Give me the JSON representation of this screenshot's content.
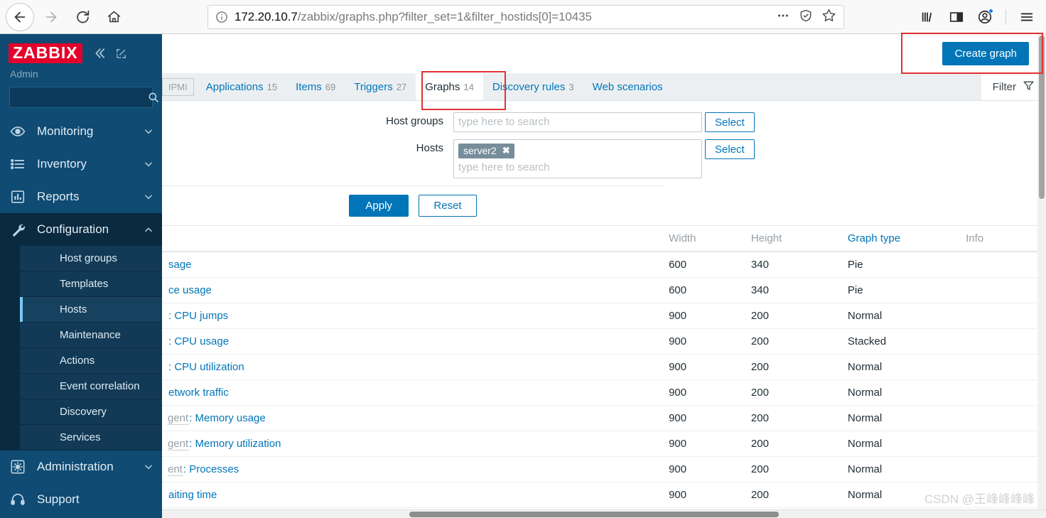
{
  "browser": {
    "back_label": "Back",
    "forward_label": "Forward",
    "reload_label": "Reload",
    "home_label": "Home",
    "url_bold": "172.20.10.7",
    "url_rest": "/zabbix/graphs.php?filter_set=1&filter_hostids[0]=10435",
    "page_actions_label": "Page actions",
    "reader_label": "Reader view",
    "bookmark_label": "Bookmark this page",
    "library_label": "Library",
    "sidebars_label": "Sidebars",
    "account_label": "Account",
    "menu_label": "Open application menu"
  },
  "sidebar": {
    "logo": "ZABBIX",
    "user": "Admin",
    "search_placeholder": "",
    "collapse_label": "Collapse sidebar",
    "expand_label": "Hide sidebar",
    "items": [
      {
        "label": "Monitoring",
        "icon": "eye-icon",
        "expandable": true
      },
      {
        "label": "Inventory",
        "icon": "list-icon",
        "expandable": true
      },
      {
        "label": "Reports",
        "icon": "bar-chart-icon",
        "expandable": true
      },
      {
        "label": "Configuration",
        "icon": "wrench-icon",
        "expandable": true,
        "expanded": true
      },
      {
        "label": "Administration",
        "icon": "gear-icon",
        "expandable": true
      },
      {
        "label": "Support",
        "icon": "headset-icon",
        "expandable": false
      }
    ],
    "configuration_submenu": [
      {
        "label": "Host groups"
      },
      {
        "label": "Templates"
      },
      {
        "label": "Hosts",
        "current": true
      },
      {
        "label": "Maintenance"
      },
      {
        "label": "Actions"
      },
      {
        "label": "Event correlation"
      },
      {
        "label": "Discovery"
      },
      {
        "label": "Services"
      }
    ]
  },
  "header": {
    "create_graph_label": "Create graph"
  },
  "tabs": [
    {
      "label": "IPMI",
      "count": "",
      "state": "disabled"
    },
    {
      "label": "Applications",
      "count": "15",
      "state": "link"
    },
    {
      "label": "Items",
      "count": "69",
      "state": "link"
    },
    {
      "label": "Triggers",
      "count": "27",
      "state": "link"
    },
    {
      "label": "Graphs",
      "count": "14",
      "state": "selected"
    },
    {
      "label": "Discovery rules",
      "count": "3",
      "state": "link"
    },
    {
      "label": "Web scenarios",
      "count": "",
      "state": "link"
    }
  ],
  "filter": {
    "toggle_label": "Filter",
    "host_groups_label": "Host groups",
    "host_groups_value": "",
    "host_groups_placeholder": "type here to search",
    "hosts_label": "Hosts",
    "hosts_placeholder": "type here to search",
    "hosts_chips": [
      {
        "label": "server2",
        "remove": "✖"
      }
    ],
    "select_label": "Select",
    "apply_label": "Apply",
    "reset_label": "Reset"
  },
  "table": {
    "columns": [
      "",
      "Width",
      "Height",
      "Graph type",
      "Info"
    ],
    "sorted_column": "Graph type",
    "rows": [
      {
        "prefix": "",
        "name": "sage",
        "width": "600",
        "height": "340",
        "type": "Pie",
        "info": ""
      },
      {
        "prefix": "",
        "name": "ce usage",
        "width": "600",
        "height": "340",
        "type": "Pie",
        "info": ""
      },
      {
        "prefix": "",
        "name": ": CPU jumps",
        "width": "900",
        "height": "200",
        "type": "Normal",
        "info": ""
      },
      {
        "prefix": "",
        "name": ": CPU usage",
        "width": "900",
        "height": "200",
        "type": "Stacked",
        "info": ""
      },
      {
        "prefix": "",
        "name": ": CPU utilization",
        "width": "900",
        "height": "200",
        "type": "Normal",
        "info": ""
      },
      {
        "prefix": "",
        "name": "etwork traffic",
        "width": "900",
        "height": "200",
        "type": "Normal",
        "info": ""
      },
      {
        "prefix": "gent",
        "name": ": Memory usage",
        "width": "900",
        "height": "200",
        "type": "Normal",
        "info": ""
      },
      {
        "prefix": "gent",
        "name": ": Memory utilization",
        "width": "900",
        "height": "200",
        "type": "Normal",
        "info": ""
      },
      {
        "prefix": "ent",
        "name": ": Processes",
        "width": "900",
        "height": "200",
        "type": "Normal",
        "info": ""
      },
      {
        "prefix": "",
        "name": "aiting time",
        "width": "900",
        "height": "200",
        "type": "Normal",
        "info": ""
      }
    ]
  },
  "watermark": "CSDN @王峰峰峰峰",
  "colors": {
    "brand_red": "#e4002b",
    "sidebar_blue": "#0f4b73",
    "sidebar_dark": "#0a2a40",
    "accent_blue": "#0275b8",
    "annotation_red": "#e03131"
  }
}
